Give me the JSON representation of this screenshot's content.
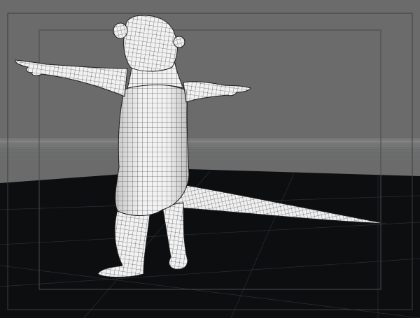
{
  "viewport": {
    "colors": {
      "background": "#6b6b6b",
      "floor": "#0b0d0f",
      "mesh_fill": "#f3f3f3",
      "wire": "#2a2a2a",
      "frame": "#3a3a3a",
      "horizon": "#9aa0a4"
    },
    "mesh_line_density": 7,
    "floor_grid_count": 6
  }
}
